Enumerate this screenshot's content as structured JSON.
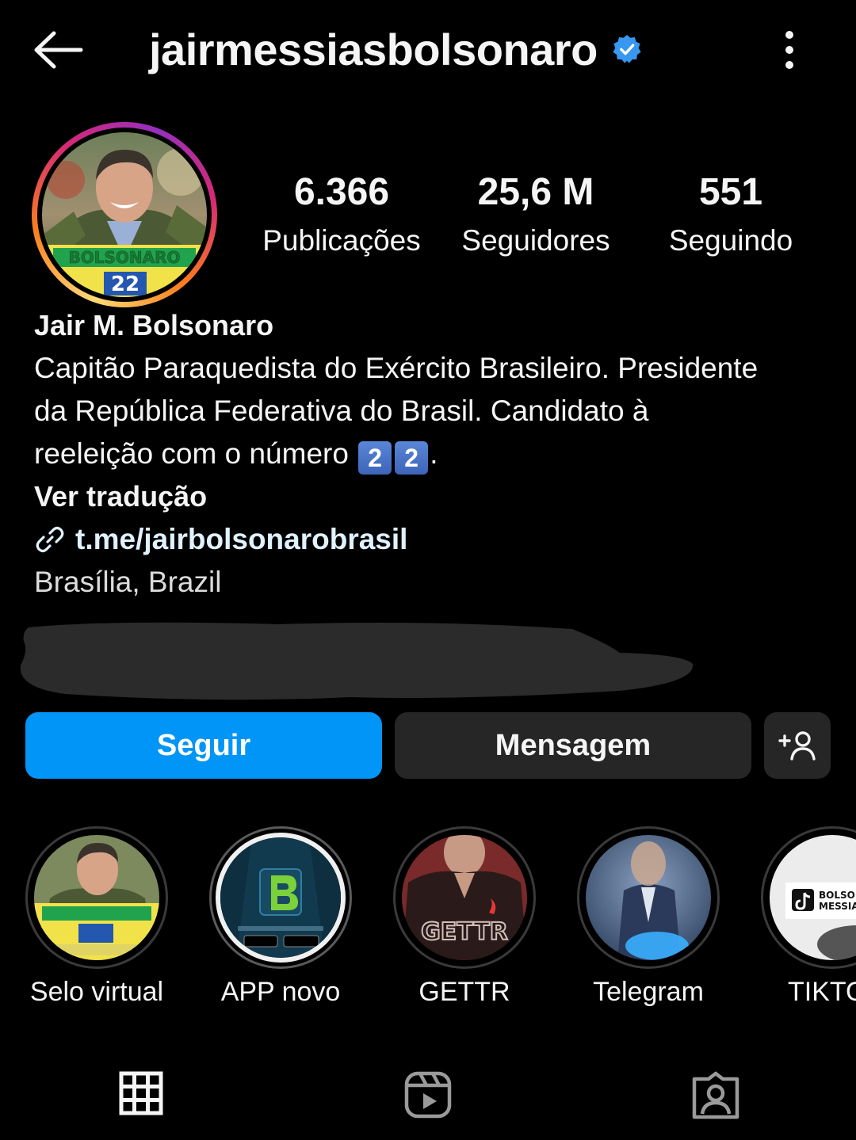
{
  "header": {
    "username": "jairmessiasbolsonaro",
    "verified": true
  },
  "stats": [
    {
      "value": "6.366",
      "label": "Publicações"
    },
    {
      "value": "25,6 M",
      "label": "Seguidores"
    },
    {
      "value": "551",
      "label": "Seguindo"
    }
  ],
  "avatar": {
    "badge_text": "BOLSONARO",
    "badge_number": "22"
  },
  "bio": {
    "name": "Jair M. Bolsonaro",
    "line1": "Capitão Paraquedista do Exército Brasileiro. Presidente",
    "line2": "da República Federativa do Brasil. Candidato à",
    "line3_prefix": "reeleição com o número ",
    "keycap_1": "2",
    "keycap_2": "2",
    "line3_suffix": ".",
    "translate": "Ver tradução",
    "link": "t.me/jairbolsonarobrasil",
    "location": "Brasília, Brazil"
  },
  "buttons": {
    "follow": "Seguir",
    "message": "Mensagem"
  },
  "highlights": [
    {
      "label": "Selo virtual",
      "icon": "bolsonaro-22-thumbnail"
    },
    {
      "label": "APP novo",
      "icon": "b-app-logo-thumbnail"
    },
    {
      "label": "GETTR",
      "icon": "gettr-thumbnail",
      "overlay_text": "GETTR"
    },
    {
      "label": "Telegram",
      "icon": "telegram-thumbnail"
    },
    {
      "label": "TIKTO",
      "icon": "tiktok-thumbnail",
      "overlay_text": "BOLSONA MESSIAS"
    }
  ],
  "tabs": [
    {
      "icon": "grid-icon"
    },
    {
      "icon": "reels-icon"
    },
    {
      "icon": "tagged-icon"
    }
  ],
  "colors": {
    "background": "#000000",
    "follow_button": "#0095f6",
    "secondary_button": "#262626",
    "verified_badge": "#3897f0"
  }
}
